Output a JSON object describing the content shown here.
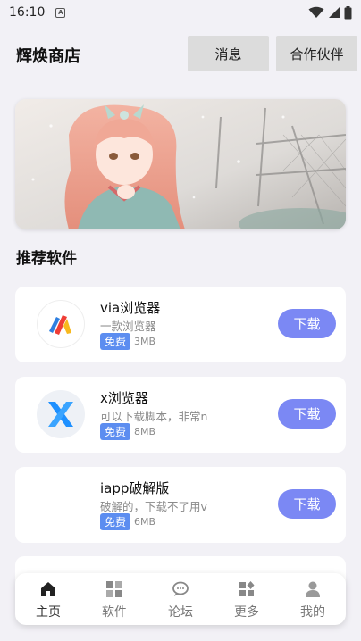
{
  "status_bar": {
    "time": "16:10",
    "notif_letter": "A"
  },
  "header": {
    "title": "辉焕商店",
    "message_label": "消息",
    "partner_label": "合作伙伴"
  },
  "section": {
    "recommended_title": "推荐软件"
  },
  "apps": [
    {
      "name": "via浏览器",
      "desc": "一款浏览器",
      "badge": "免费",
      "size": "3MB",
      "download_label": "下载",
      "icon": "via-browser-icon"
    },
    {
      "name": "x浏览器",
      "desc": "可以下载脚本，非常n",
      "badge": "免费",
      "size": "8MB",
      "download_label": "下载",
      "icon": "x-browser-icon"
    },
    {
      "name": "iapp破解版",
      "desc": "破解的，下载不了用v",
      "badge": "免费",
      "size": "6MB",
      "download_label": "下载",
      "icon": ""
    }
  ],
  "bottom_nav": [
    {
      "label": "主页",
      "icon": "home-icon",
      "active": true
    },
    {
      "label": "软件",
      "icon": "apps-grid-icon",
      "active": false
    },
    {
      "label": "论坛",
      "icon": "chat-icon",
      "active": false
    },
    {
      "label": "更多",
      "icon": "more-icon",
      "active": false
    },
    {
      "label": "我的",
      "icon": "profile-icon",
      "active": false
    }
  ],
  "colors": {
    "accent": "#7b88f4",
    "badge": "#5c8df0",
    "background": "#f2f1f6"
  }
}
